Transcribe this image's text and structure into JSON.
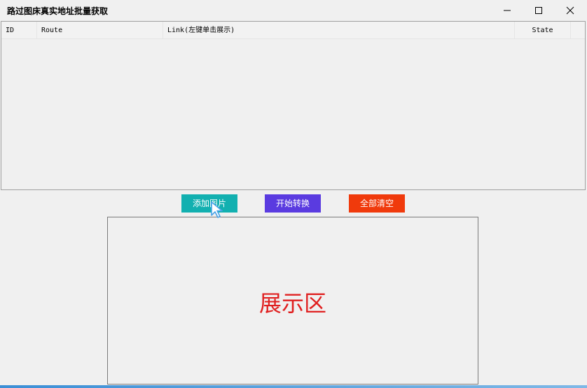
{
  "window": {
    "title": "路过图床真实地址批量获取",
    "controls": [
      "minimize",
      "maximize",
      "close"
    ]
  },
  "list": {
    "columns": [
      "ID",
      "Route",
      "Link(左键单击展示)",
      "State"
    ],
    "rows": []
  },
  "buttons": {
    "add": {
      "label": "添加图片",
      "color": "#12b0b0"
    },
    "start": {
      "label": "开始转换",
      "color": "#5a3be0"
    },
    "clear": {
      "label": "全部清空",
      "color": "#f03a0c"
    }
  },
  "display": {
    "label": "展示区",
    "label_color": "#e02020"
  },
  "icons": [
    "minimize-icon",
    "maximize-icon",
    "close-icon",
    "mouse-cursor-icon"
  ]
}
